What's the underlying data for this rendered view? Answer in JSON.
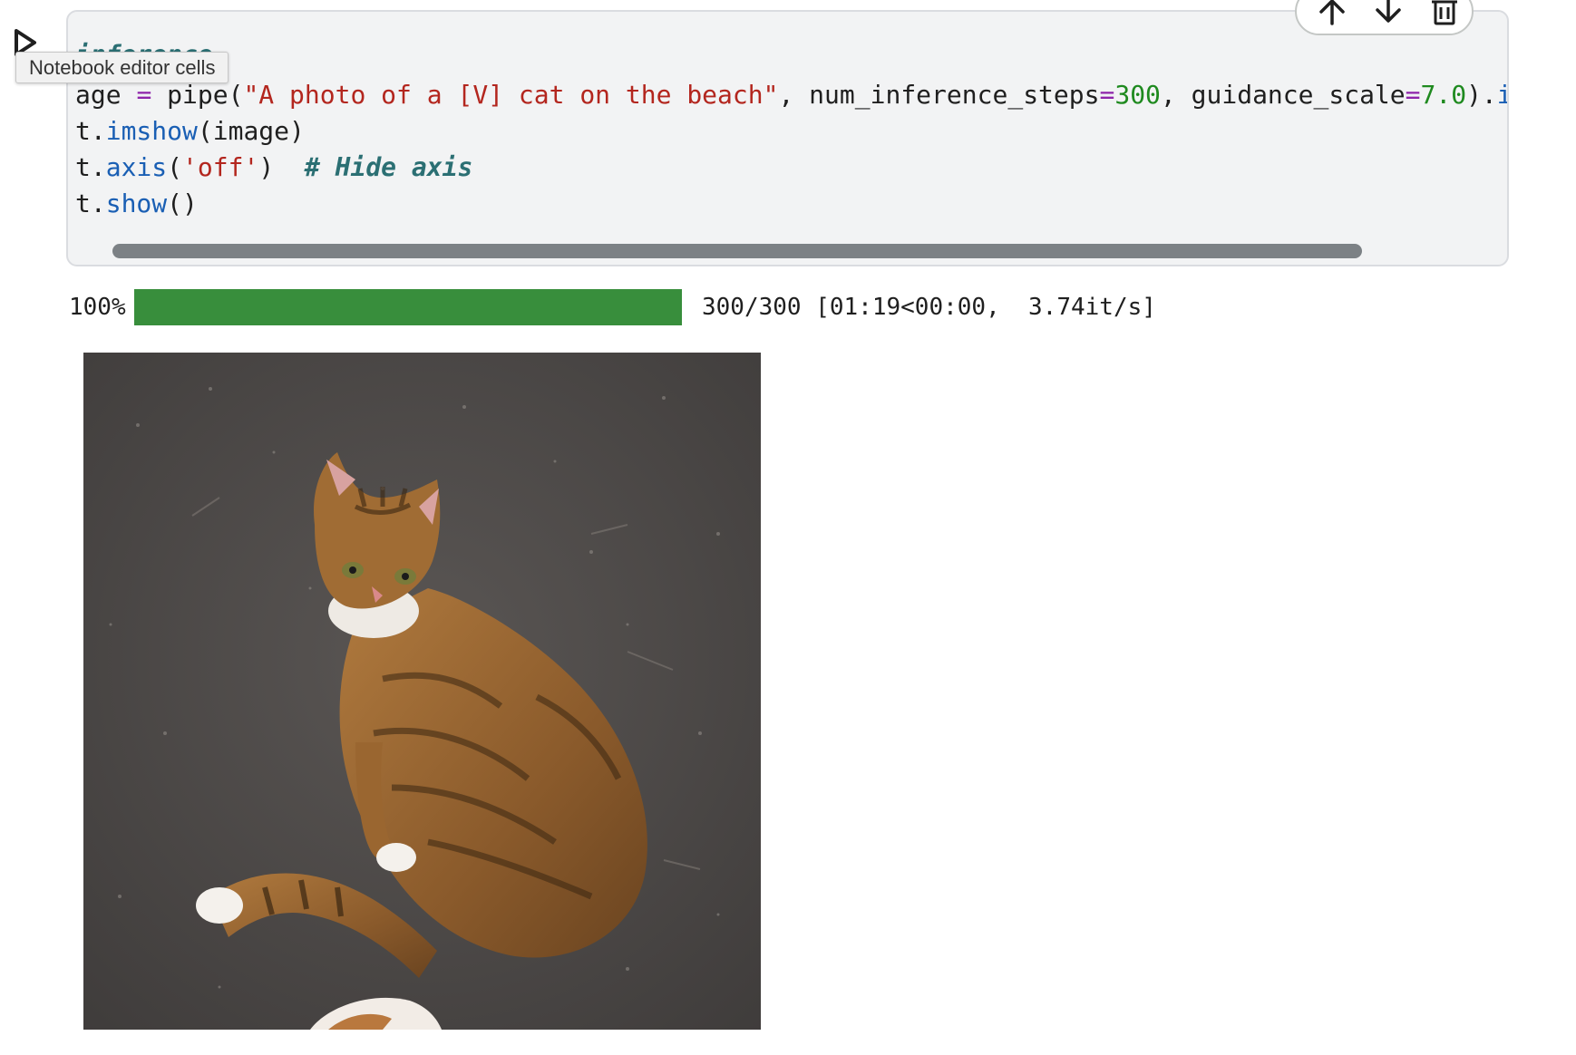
{
  "cell": {
    "heading_comment": "inference",
    "code_lines": [
      [
        {
          "t": "age ",
          "c": ""
        },
        {
          "t": "=",
          "c": "op"
        },
        {
          "t": " pipe(",
          "c": ""
        },
        {
          "t": "\"A photo of a [V] cat on the beach\"",
          "c": "st"
        },
        {
          "t": ", num_inference_steps",
          "c": ""
        },
        {
          "t": "=",
          "c": "op"
        },
        {
          "t": "300",
          "c": "nu"
        },
        {
          "t": ", guidance_scale",
          "c": ""
        },
        {
          "t": "=",
          "c": "op"
        },
        {
          "t": "7.0",
          "c": "nu"
        },
        {
          "t": ").",
          "c": ""
        },
        {
          "t": "i",
          "c": "fn"
        }
      ],
      [
        {
          "t": "t.",
          "c": ""
        },
        {
          "t": "imshow",
          "c": "fn"
        },
        {
          "t": "(image)",
          "c": ""
        }
      ],
      [
        {
          "t": "t.",
          "c": ""
        },
        {
          "t": "axis",
          "c": "fn"
        },
        {
          "t": "(",
          "c": ""
        },
        {
          "t": "'off'",
          "c": "st"
        },
        {
          "t": ")  ",
          "c": ""
        },
        {
          "t": "# Hide axis",
          "c": "cm"
        }
      ],
      [
        {
          "t": "t.",
          "c": ""
        },
        {
          "t": "show",
          "c": "fn"
        },
        {
          "t": "()",
          "c": ""
        }
      ]
    ]
  },
  "toolbar": {
    "icons": [
      "arrow-up-icon",
      "arrow-down-icon",
      "trash-icon"
    ]
  },
  "tooltip": {
    "text": "Notebook editor cells"
  },
  "progress": {
    "percent_label": "100%",
    "fraction": 1.0,
    "stats": "300/300 [01:19<00:00,  3.74it/s]",
    "color": "#388e3c"
  },
  "output": {
    "image_desc_icon": "cat-photo-image"
  }
}
